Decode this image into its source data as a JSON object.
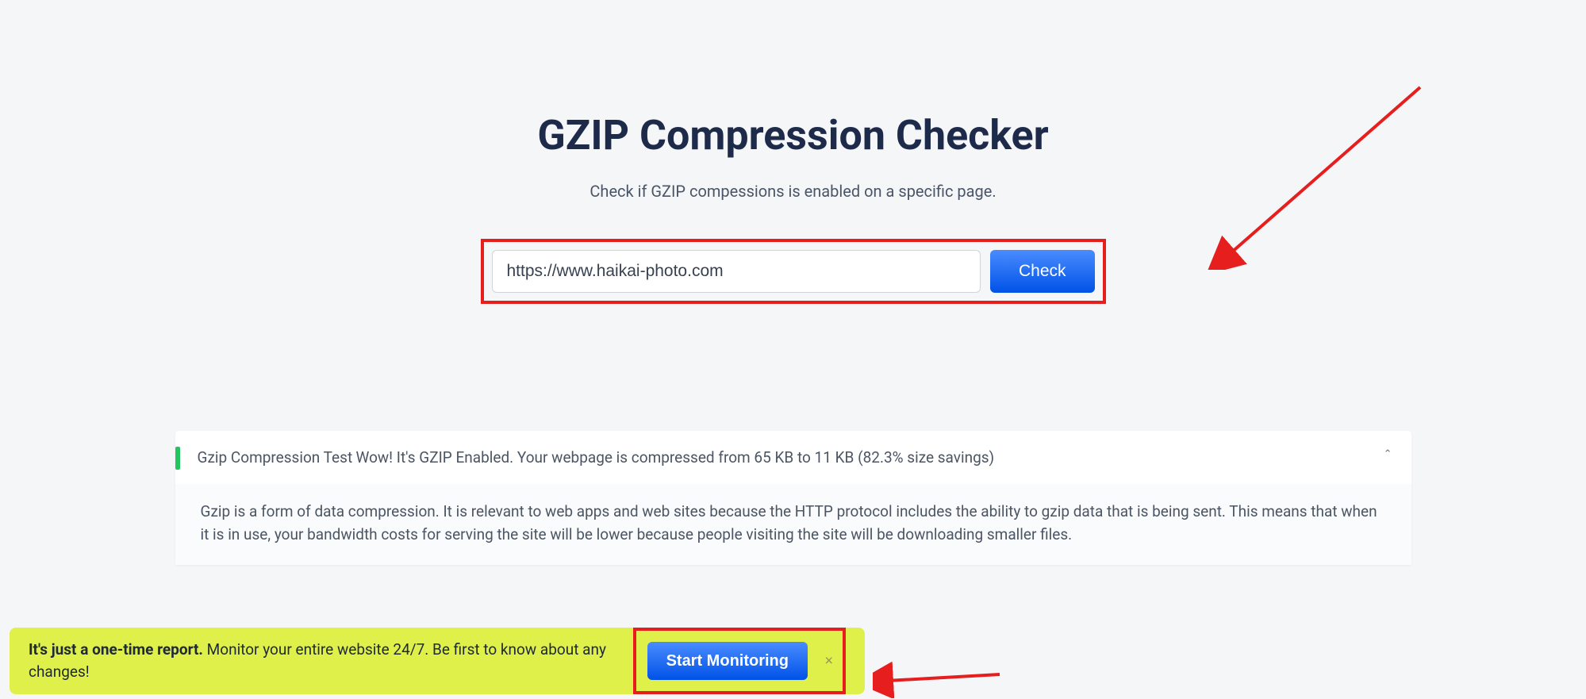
{
  "header": {
    "title": "GZIP Compression Checker",
    "subtitle": "Check if GZIP compessions is enabled on a specific page."
  },
  "form": {
    "url_value": "https://www.haikai-photo.com",
    "check_label": "Check"
  },
  "result": {
    "label": "Gzip Compression Test",
    "summary": "Wow! It's GZIP Enabled. Your webpage is compressed from 65 KB to 11 KB (82.3% size savings)",
    "description": "Gzip is a form of data compression. It is relevant to web apps and web sites because the HTTP protocol includes the ability to gzip data that is being sent. This means that when it is in use, your bandwidth costs for serving the site will be lower because people visiting the site will be downloading smaller files."
  },
  "banner": {
    "strong": "It's just a one-time report.",
    "rest": " Monitor your entire website 24/7. Be first to know about any changes!",
    "button": "Start Monitoring"
  }
}
